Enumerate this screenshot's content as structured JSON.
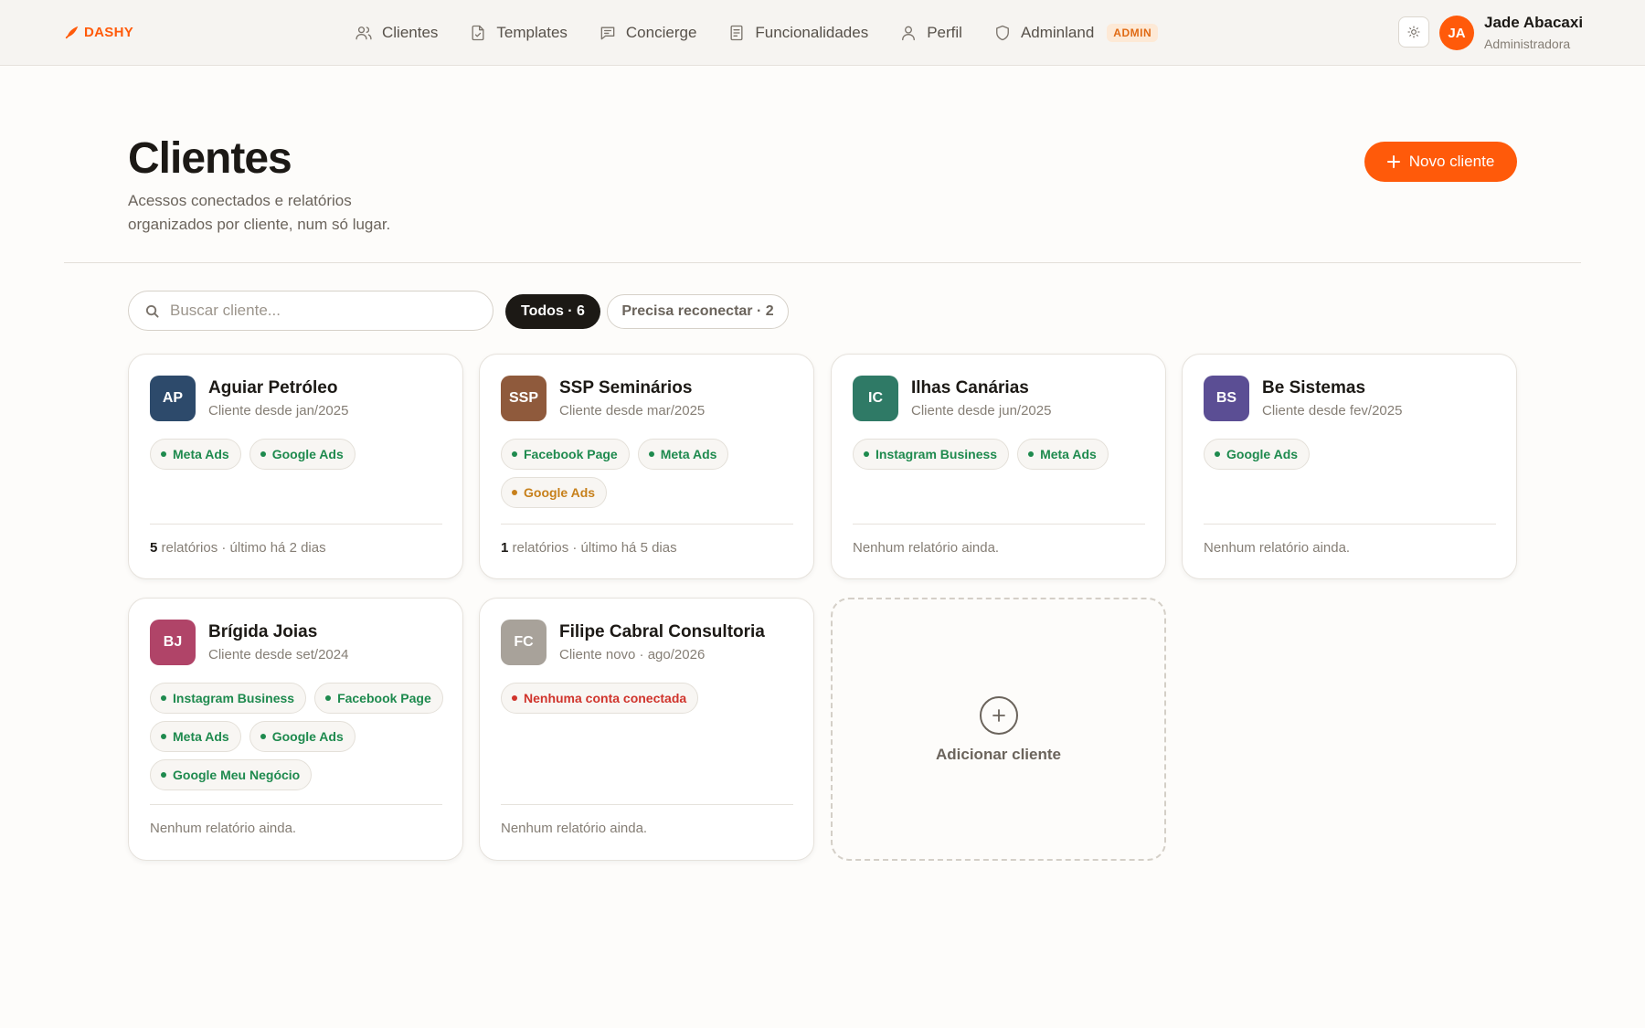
{
  "header": {
    "logo_text": "DASHY",
    "nav": [
      {
        "label": "Clientes",
        "icon": "users-icon"
      },
      {
        "label": "Templates",
        "icon": "file-check-icon"
      },
      {
        "label": "Concierge",
        "icon": "message-icon"
      },
      {
        "label": "Funcionalidades",
        "icon": "document-icon"
      },
      {
        "label": "Perfil",
        "icon": "user-icon"
      },
      {
        "label": "Adminland",
        "icon": "shield-icon",
        "badge": "ADMIN"
      }
    ],
    "user": {
      "initials": "JA",
      "name": "Jade Abacaxi",
      "role": "Administradora"
    }
  },
  "page": {
    "title": "Clientes",
    "subtitle": "Acessos conectados e relatórios organizados por cliente, num só lugar.",
    "new_button": "Novo cliente"
  },
  "filters": {
    "search_placeholder": "Buscar cliente...",
    "all_label": "Todos · 6",
    "reconnect_label": "Precisa reconectar · 2"
  },
  "clients": [
    {
      "initials": "AP",
      "color": "#2d4a6b",
      "name": "Aguiar Petróleo",
      "since": "Cliente desde jan/2025",
      "tags": [
        {
          "label": "Meta Ads",
          "status": "ok"
        },
        {
          "label": "Google Ads",
          "status": "ok"
        }
      ],
      "reports_count": "5",
      "reports_text": "relatórios · último há 2 dias"
    },
    {
      "initials": "SSP",
      "color": "#8f5a3c",
      "name": "SSP Seminários",
      "since": "Cliente desde mar/2025",
      "tags": [
        {
          "label": "Facebook Page",
          "status": "ok"
        },
        {
          "label": "Meta Ads",
          "status": "ok"
        },
        {
          "label": "Google Ads",
          "status": "warn"
        }
      ],
      "reports_count": "1",
      "reports_text": "relatórios · último há 5 dias"
    },
    {
      "initials": "IC",
      "color": "#2f7a66",
      "name": "Ilhas Canárias",
      "since": "Cliente desde jun/2025",
      "tags": [
        {
          "label": "Instagram Business",
          "status": "ok"
        },
        {
          "label": "Meta Ads",
          "status": "ok"
        }
      ],
      "reports_count": "",
      "reports_text": "Nenhum relatório ainda."
    },
    {
      "initials": "BS",
      "color": "#5b4e94",
      "name": "Be Sistemas",
      "since": "Cliente desde fev/2025",
      "tags": [
        {
          "label": "Google Ads",
          "status": "ok"
        }
      ],
      "reports_count": "",
      "reports_text": "Nenhum relatório ainda."
    },
    {
      "initials": "BJ",
      "color": "#b04468",
      "name": "Brígida Joias",
      "since": "Cliente desde set/2024",
      "tags": [
        {
          "label": "Instagram Business",
          "status": "ok"
        },
        {
          "label": "Facebook Page",
          "status": "ok"
        },
        {
          "label": "Meta Ads",
          "status": "ok"
        },
        {
          "label": "Google Ads",
          "status": "ok"
        },
        {
          "label": "Google Meu Negócio",
          "status": "ok"
        }
      ],
      "reports_count": "",
      "reports_text": "Nenhum relatório ainda."
    },
    {
      "initials": "FC",
      "color": "#a8a29a",
      "name": "Filipe Cabral Consultoria",
      "since": "Cliente novo · ago/2026",
      "tags": [
        {
          "label": "Nenhuma conta conectada",
          "status": "err"
        }
      ],
      "reports_count": "",
      "reports_text": "Nenhum relatório ainda."
    }
  ],
  "add_card": {
    "label": "Adicionar cliente"
  }
}
